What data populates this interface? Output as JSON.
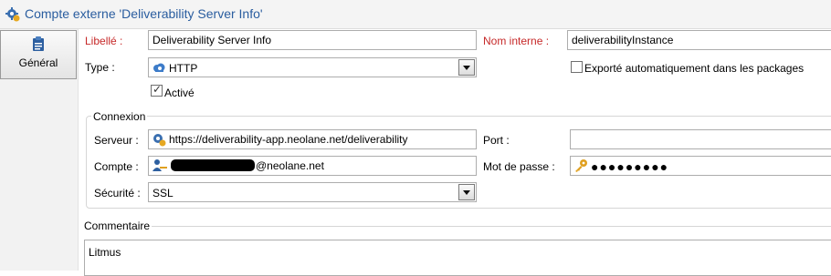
{
  "window": {
    "title": "Compte externe 'Deliverability Server Info'",
    "icon": "gear-icon"
  },
  "sidebar": {
    "tab_label": "Général",
    "tab_icon": "clipboard-icon"
  },
  "form": {
    "label_libelle": "Libellé :",
    "value_libelle": "Deliverability Server Info",
    "label_nom_interne": "Nom interne :",
    "value_nom_interne": "deliverabilityInstance",
    "label_type": "Type :",
    "type_selected": "HTTP",
    "type_icon": "cloud-icon",
    "export_label": "Exporté automatiquement dans les packages",
    "export_checked": false,
    "active_label": "Activé",
    "active_checked": true
  },
  "connexion": {
    "legend": "Connexion",
    "label_serveur": "Serveur :",
    "value_serveur": "https://deliverability-app.neolane.net/deliverability",
    "label_port": "Port :",
    "value_port": "",
    "label_compte": "Compte :",
    "value_compte": "@neolane.net",
    "label_mdp": "Mot de passe :",
    "value_mdp": "●●●●●●●●●",
    "label_securite": "Sécurité :",
    "securite_selected": "SSL"
  },
  "comment": {
    "legend": "Commentaire",
    "value": "Litmus"
  },
  "colors": {
    "title_blue": "#2a5d9f",
    "required_red": "#c62828",
    "key_gold": "#e0a020"
  }
}
